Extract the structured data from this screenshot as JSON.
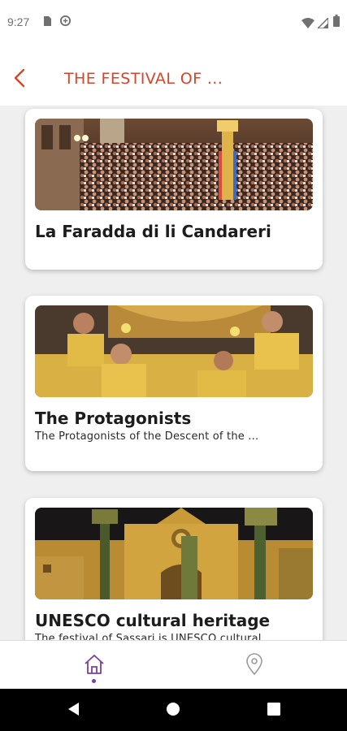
{
  "status_bar": {
    "time": "9:27",
    "icons": [
      "sim-card-icon",
      "data-saver-icon",
      "wifi-icon",
      "signal-icon",
      "battery-icon"
    ]
  },
  "header": {
    "title": "THE FESTIVAL OF ...",
    "back_icon": "chevron-left-icon",
    "accent_color": "#d2472c"
  },
  "cards": [
    {
      "title": "La Faradda di li Candareri",
      "subtitle": "",
      "image": "crowd-with-candlesticks-photo"
    },
    {
      "title": "The Protagonists",
      "subtitle": "The Protagonists of the Descent of the ...",
      "image": "bearers-in-yellow-shirts-photo"
    },
    {
      "title": "UNESCO cultural heritage",
      "subtitle": "The festival of Sassari is UNESCO cultural ...",
      "image": "church-at-night-photo"
    }
  ],
  "bottom_nav": {
    "items": [
      "home-icon",
      "map-pin-icon"
    ],
    "active": "home-icon",
    "active_color": "#7b3fa0"
  },
  "system_nav": [
    "back-triangle-icon",
    "home-circle-icon",
    "recents-square-icon"
  ]
}
